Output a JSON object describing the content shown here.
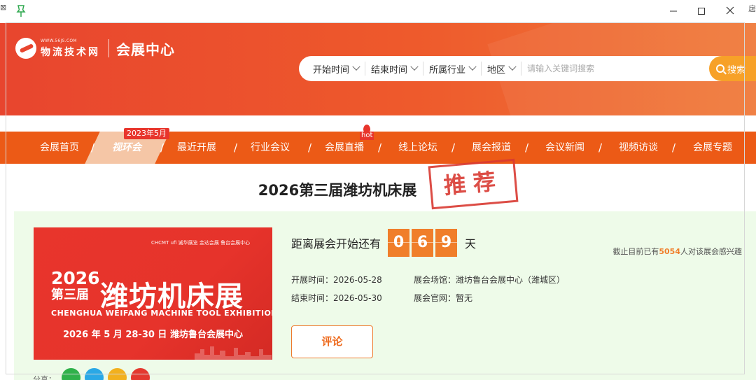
{
  "logo": {
    "url": "WWW.56JS.COM",
    "name": "物流技术网",
    "section": "会展中心"
  },
  "search": {
    "filters": [
      "开始时间",
      "结束时间",
      "所属行业",
      "地区"
    ],
    "placeholder": "请输入关键词搜索",
    "button_label": "搜索"
  },
  "nav": {
    "items": [
      "会展首页",
      "视环会",
      "最近开展",
      "行业会议",
      "会展直播",
      "线上论坛",
      "展会报道",
      "会议新闻",
      "视频访谈",
      "会展专题"
    ],
    "active_badge": "2023年5月",
    "hot_badge": "hot"
  },
  "event": {
    "title": "2026第三届潍坊机床展",
    "stamp": "推荐",
    "poster": {
      "logos": "CHCMT  ufi  诚华展览  金达会展  鲁台会展中心",
      "year": "2026",
      "edition": "第三届",
      "name": "潍坊机床展",
      "english": "CHENGHUA WEIFANG MACHINE TOOL EXHIBITION",
      "date": "2026 年 5 月 28-30 日    潍坊鲁台会展中心"
    },
    "countdown_label": "距离展会开始还有",
    "countdown_digits": [
      "0",
      "6",
      "9"
    ],
    "countdown_unit": "天",
    "interest_prefix": "截止目前已有",
    "interest_count": "5054",
    "interest_suffix": "人对该展会感兴趣",
    "start_time": "开展时间：2026-05-28",
    "end_time": "结束时间：2026-05-30",
    "venue": "展会场馆：潍坊鲁台会展中心（潍城区）",
    "website": "展会官网：暂无",
    "comment_label": "评论",
    "share_label": "分享："
  },
  "colors": {
    "banner": "#e8452e",
    "nav": "#ec5a16",
    "accent": "#f07e2a",
    "search_button": "#f7a128",
    "panel": "#eefbe9"
  }
}
